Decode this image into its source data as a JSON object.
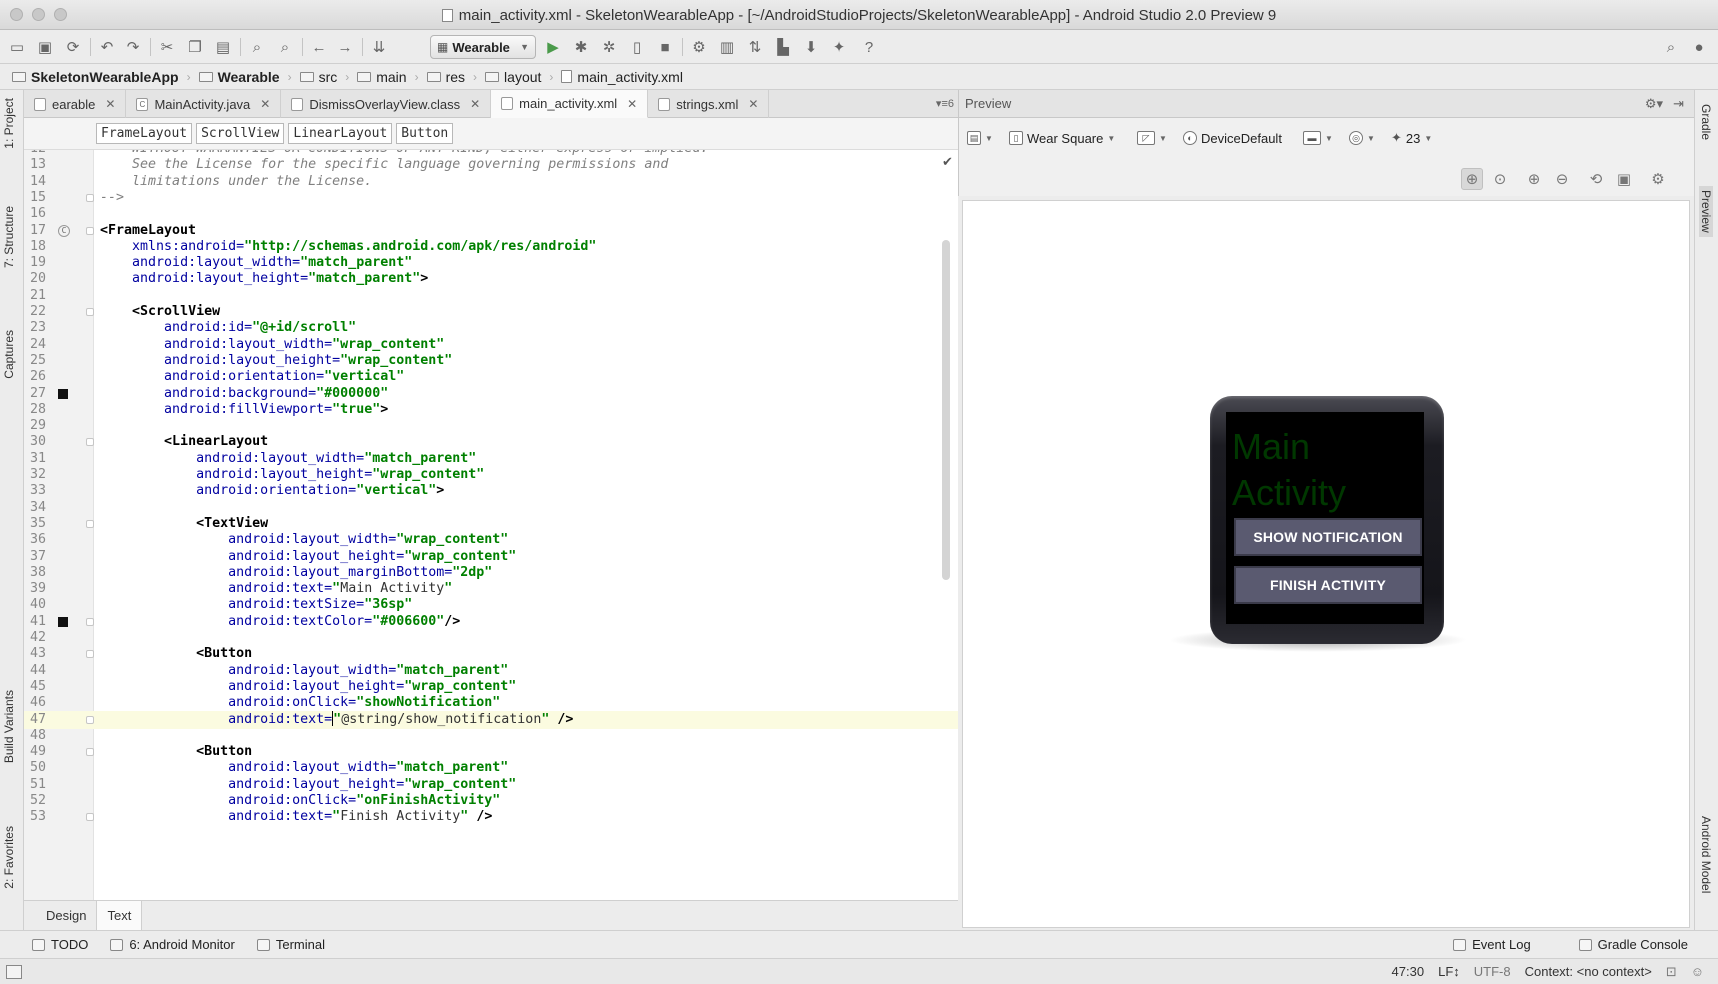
{
  "window": {
    "title": "main_activity.xml - SkeletonWearableApp - [~/AndroidStudioProjects/SkeletonWearableApp] - Android Studio 2.0 Preview 9"
  },
  "toolbar": {
    "run_config": "Wearable",
    "icons": [
      "open-icon",
      "save-icon",
      "sync-icon",
      "undo-icon",
      "redo-icon",
      "cut-icon",
      "copy-icon",
      "paste-icon",
      "find-icon",
      "replace-icon",
      "back-icon",
      "forward-icon",
      "make-icon",
      "run-icon",
      "debug-icon",
      "attach-icon",
      "apply-changes-icon",
      "stop-icon",
      "sdk-icon",
      "avd-icon",
      "gradle-sync-icon",
      "device-monitor-icon",
      "help-icon",
      "search-icon"
    ]
  },
  "breadcrumb": [
    "SkeletonWearableApp",
    "Wearable",
    "src",
    "main",
    "res",
    "layout",
    "main_activity.xml"
  ],
  "left_tools": [
    "1: Project",
    "7: Structure",
    "Captures",
    "Build Variants",
    "2: Favorites"
  ],
  "right_tools": [
    "Gradle",
    "Preview",
    "Android Model"
  ],
  "editor": {
    "tabs": [
      {
        "label": "earable",
        "icon": ""
      },
      {
        "label": "MainActivity.java",
        "icon": "C"
      },
      {
        "label": "DismissOverlayView.class",
        "icon": ""
      },
      {
        "label": "main_activity.xml",
        "icon": "",
        "active": true
      },
      {
        "label": "strings.xml",
        "icon": ""
      }
    ],
    "tabs_more": "6",
    "xml_breadcrumbs": [
      "FrameLayout",
      "ScrollView",
      "LinearLayout",
      "Button"
    ],
    "current_line": "47",
    "lines": [
      {
        "n": "12",
        "html": "<span class=\"cmt\">    WITHOUT WARRANTIES OR CONDITIONS OF ANY KIND, either express or implied.</span>"
      },
      {
        "n": "13",
        "html": "<span class=\"cmt\">    See the License for the specific language governing permissions and</span>"
      },
      {
        "n": "14",
        "html": "<span class=\"cmt\">    limitations under the License.</span>"
      },
      {
        "n": "15",
        "html": "<span class=\"cmt\">--&gt;</span>",
        "fold": true
      },
      {
        "n": "16",
        "html": ""
      },
      {
        "n": "17",
        "html": "<span class=\"tag\">&lt;FrameLayout</span>",
        "fold": true,
        "mark": "circle"
      },
      {
        "n": "18",
        "html": "    <span class=\"attrn\">xmlns:android=</span><span class=\"val\">\"http://schemas.android.com/apk/res/android\"</span>"
      },
      {
        "n": "19",
        "html": "    <span class=\"attrn\">android:layout_width=</span><span class=\"val\">\"match_parent\"</span>"
      },
      {
        "n": "20",
        "html": "    <span class=\"attrn\">android:layout_height=</span><span class=\"val\">\"match_parent\"</span><span class=\"tag\">&gt;</span>"
      },
      {
        "n": "21",
        "html": ""
      },
      {
        "n": "22",
        "html": "    <span class=\"tag\">&lt;ScrollView</span>",
        "fold": true
      },
      {
        "n": "23",
        "html": "        <span class=\"attrn\">android:id=</span><span class=\"val\">\"@+id/scroll\"</span>"
      },
      {
        "n": "24",
        "html": "        <span class=\"attrn\">android:layout_width=</span><span class=\"val\">\"wrap_content\"</span>"
      },
      {
        "n": "25",
        "html": "        <span class=\"attrn\">android:layout_height=</span><span class=\"val\">\"wrap_content\"</span>"
      },
      {
        "n": "26",
        "html": "        <span class=\"attrn\">android:orientation=</span><span class=\"val\">\"vertical\"</span>"
      },
      {
        "n": "27",
        "html": "        <span class=\"attrn\">android:background=</span><span class=\"val\">\"#000000\"</span>",
        "mark": "square"
      },
      {
        "n": "28",
        "html": "        <span class=\"attrn\">android:fillViewport=</span><span class=\"val\">\"true\"</span><span class=\"tag\">&gt;</span>"
      },
      {
        "n": "29",
        "html": ""
      },
      {
        "n": "30",
        "html": "        <span class=\"tag\">&lt;LinearLayout</span>",
        "fold": true
      },
      {
        "n": "31",
        "html": "            <span class=\"attrn\">android:layout_width=</span><span class=\"val\">\"match_parent\"</span>"
      },
      {
        "n": "32",
        "html": "            <span class=\"attrn\">android:layout_height=</span><span class=\"val\">\"wrap_content\"</span>"
      },
      {
        "n": "33",
        "html": "            <span class=\"attrn\">android:orientation=</span><span class=\"val\">\"vertical\"</span><span class=\"tag\">&gt;</span>"
      },
      {
        "n": "34",
        "html": ""
      },
      {
        "n": "35",
        "html": "            <span class=\"tag\">&lt;TextView</span>",
        "fold": true
      },
      {
        "n": "36",
        "html": "                <span class=\"attrn\">android:layout_width=</span><span class=\"val\">\"wrap_content\"</span>"
      },
      {
        "n": "37",
        "html": "                <span class=\"attrn\">android:layout_height=</span><span class=\"val\">\"wrap_content\"</span>"
      },
      {
        "n": "38",
        "html": "                <span class=\"attrn\">android:layout_marginBottom=</span><span class=\"val\">\"2dp\"</span>"
      },
      {
        "n": "39",
        "html": "                <span class=\"attrn\">android:text=</span><span class=\"val\">\"</span><span class=\"val val-ref\">Main Activity</span><span class=\"val\">\"</span>"
      },
      {
        "n": "40",
        "html": "                <span class=\"attrn\">android:textSize=</span><span class=\"val\">\"36sp\"</span>"
      },
      {
        "n": "41",
        "html": "                <span class=\"attrn\">android:textColor=</span><span class=\"val\">\"#006600\"</span><span class=\"tag\">/&gt;</span>",
        "fold": true,
        "mark": "square"
      },
      {
        "n": "42",
        "html": ""
      },
      {
        "n": "43",
        "html": "            <span class=\"tag\">&lt;Button</span>",
        "fold": true
      },
      {
        "n": "44",
        "html": "                <span class=\"attrn\">android:layout_width=</span><span class=\"val\">\"match_parent\"</span>"
      },
      {
        "n": "45",
        "html": "                <span class=\"attrn\">android:layout_height=</span><span class=\"val\">\"wrap_content\"</span>"
      },
      {
        "n": "46",
        "html": "                <span class=\"attrn\">android:onClick=</span><span class=\"val\">\"showNotification\"</span>"
      },
      {
        "n": "47",
        "html": "                <span class=\"attrn\">android:text=</span><span class=\"caret-mark\"></span><span class=\"val\">\"</span><span class=\"val val-ref\">@string/show_notification</span><span class=\"val\">\"</span> <span class=\"tag\">/&gt;</span>",
        "fold": true
      },
      {
        "n": "48",
        "html": ""
      },
      {
        "n": "49",
        "html": "            <span class=\"tag\">&lt;Button</span>",
        "fold": true
      },
      {
        "n": "50",
        "html": "                <span class=\"attrn\">android:layout_width=</span><span class=\"val\">\"match_parent\"</span>"
      },
      {
        "n": "51",
        "html": "                <span class=\"attrn\">android:layout_height=</span><span class=\"val\">\"wrap_content\"</span>"
      },
      {
        "n": "52",
        "html": "                <span class=\"attrn\">android:onClick=</span><span class=\"val\">\"onFinishActivity\"</span>"
      },
      {
        "n": "53",
        "html": "                <span class=\"attrn\">android:text=</span><span class=\"val\">\"</span><span class=\"val val-ref\">Finish Activity</span><span class=\"val\">\"</span> <span class=\"tag\">/&gt;</span>",
        "fold": true
      }
    ],
    "bottom_tabs": [
      {
        "label": "Design"
      },
      {
        "label": "Text",
        "active": true
      }
    ]
  },
  "preview": {
    "header": "Preview",
    "device": "Wear Square",
    "theme": "DeviceDefault",
    "api": "23",
    "app_title": "Main Activity",
    "app_title_color": "#006600",
    "buttons": [
      "SHOW NOTIFICATION",
      "FINISH ACTIVITY"
    ]
  },
  "bottom_tools": {
    "left": [
      "TODO",
      "6: Android Monitor",
      "Terminal"
    ],
    "right": [
      "Event Log",
      "Gradle Console"
    ]
  },
  "status": {
    "position": "47:30",
    "line_sep": "LF↕",
    "encoding": "UTF-8",
    "context": "Context: <no context>"
  }
}
